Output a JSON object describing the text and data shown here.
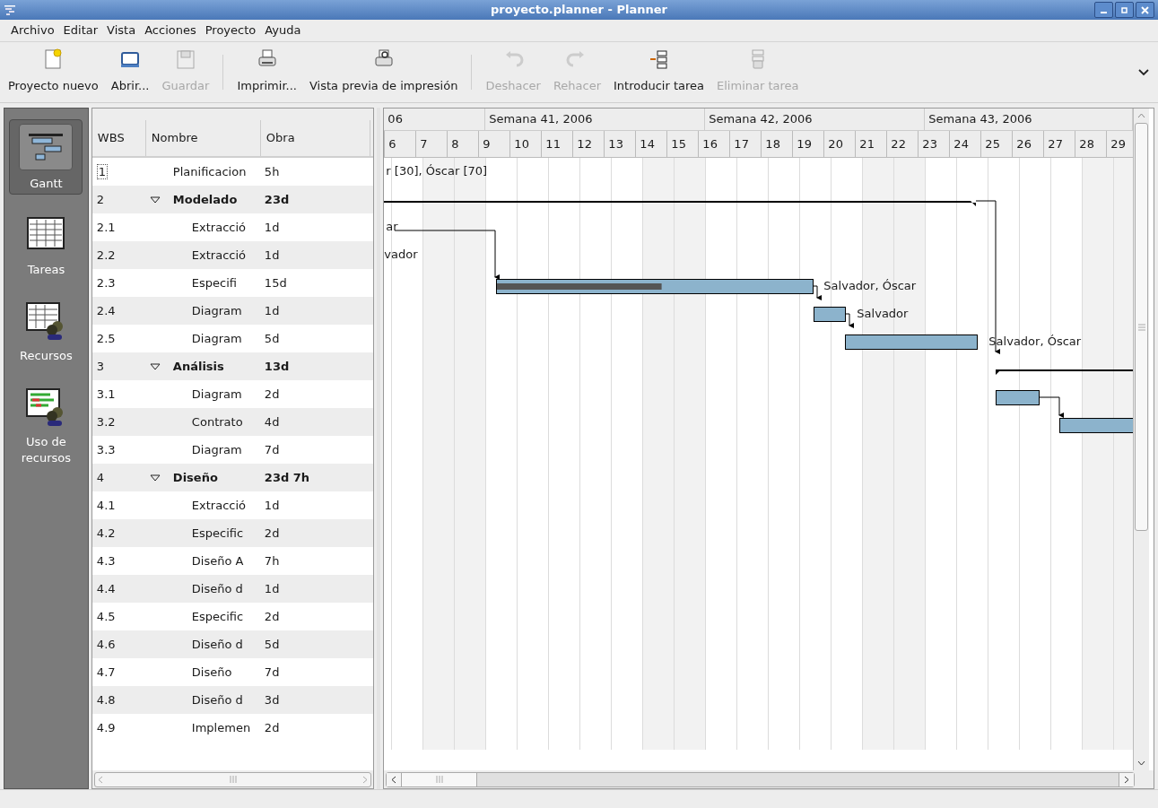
{
  "window": {
    "title": "proyecto.planner - Planner"
  },
  "menu": [
    "Archivo",
    "Editar",
    "Vista",
    "Acciones",
    "Proyecto",
    "Ayuda"
  ],
  "toolbar": [
    {
      "kind": "new",
      "label": "Proyecto nuevo",
      "disabled": false
    },
    {
      "kind": "open",
      "label": "Abrir...",
      "disabled": false
    },
    {
      "kind": "save",
      "label": "Guardar",
      "disabled": true
    },
    {
      "kind": "separator"
    },
    {
      "kind": "print",
      "label": "Imprimir...",
      "disabled": false
    },
    {
      "kind": "preview",
      "label": "Vista previa de impresión",
      "disabled": false
    },
    {
      "kind": "separator"
    },
    {
      "kind": "undo",
      "label": "Deshacer",
      "disabled": true
    },
    {
      "kind": "redo",
      "label": "Rehacer",
      "disabled": true
    },
    {
      "kind": "insert",
      "label": "Introducir tarea",
      "disabled": false
    },
    {
      "kind": "delete",
      "label": "Eliminar tarea",
      "disabled": true
    }
  ],
  "sidebar": [
    {
      "kind": "gantt",
      "label": "Gantt",
      "selected": true
    },
    {
      "kind": "tasks",
      "label": "Tareas",
      "selected": false
    },
    {
      "kind": "resources",
      "label": "Recursos",
      "selected": false
    },
    {
      "kind": "usage",
      "label": "Uso de recursos",
      "selected": false
    }
  ],
  "task_table": {
    "columns": [
      "WBS",
      "Nombre",
      "Obra"
    ],
    "rows": [
      {
        "wbs": "1",
        "name": "Planificacion",
        "work": "5h"
      },
      {
        "wbs": "2",
        "name": "Modelado",
        "work": "23d",
        "expanded": true,
        "children": [
          {
            "wbs": "2.1",
            "name": "Extracció",
            "work": "1d"
          },
          {
            "wbs": "2.2",
            "name": "Extracció",
            "work": "1d"
          },
          {
            "wbs": "2.3",
            "name": "Especifi",
            "work": "15d"
          },
          {
            "wbs": "2.4",
            "name": "Diagram",
            "work": "1d"
          },
          {
            "wbs": "2.5",
            "name": "Diagram",
            "work": "5d"
          }
        ]
      },
      {
        "wbs": "3",
        "name": "Análisis",
        "work": "13d",
        "expanded": true,
        "children": [
          {
            "wbs": "3.1",
            "name": "Diagram",
            "work": "2d"
          },
          {
            "wbs": "3.2",
            "name": "Contrato",
            "work": "4d"
          },
          {
            "wbs": "3.3",
            "name": "Diagram",
            "work": "7d"
          }
        ]
      },
      {
        "wbs": "4",
        "name": "Diseño",
        "work": "23d 7h",
        "expanded": true,
        "children": [
          {
            "wbs": "4.1",
            "name": "Extracció",
            "work": "1d"
          },
          {
            "wbs": "4.2",
            "name": "Especific",
            "work": "2d"
          },
          {
            "wbs": "4.3",
            "name": "Diseño A",
            "work": "7h"
          },
          {
            "wbs": "4.4",
            "name": "Diseño d",
            "work": "1d"
          },
          {
            "wbs": "4.5",
            "name": "Especific",
            "work": "2d"
          },
          {
            "wbs": "4.6",
            "name": "Diseño d",
            "work": "5d"
          },
          {
            "wbs": "4.7",
            "name": "Diseño",
            "work": "7d"
          },
          {
            "wbs": "4.8",
            "name": "Diseño d",
            "work": "3d"
          },
          {
            "wbs": "4.9",
            "name": "Implemen",
            "work": "2d"
          }
        ]
      }
    ]
  },
  "gantt": {
    "weeks": [
      "06",
      "Semana 41, 2006",
      "Semana 42, 2006",
      "Semana 43, 2006"
    ],
    "days": [
      "6",
      "7",
      "8",
      "9",
      "10",
      "11",
      "12",
      "13",
      "14",
      "15",
      "16",
      "17",
      "18",
      "19",
      "20",
      "21",
      "22",
      "23",
      "24",
      "25",
      "26",
      "27",
      "28",
      "29"
    ],
    "rows": [
      {
        "kind": "label",
        "label": "r [30], Óscar [70]"
      },
      {
        "kind": "summary"
      },
      {
        "kind": "label",
        "label": "ar"
      },
      {
        "kind": "label",
        "label": "vador"
      },
      {
        "kind": "task",
        "label": "Salvador, Óscar",
        "level": 0.52
      },
      {
        "kind": "task",
        "label": "Salvador"
      },
      {
        "kind": "task",
        "label": "Salvador, Óscar"
      },
      {
        "kind": "summary"
      },
      {
        "kind": "task"
      },
      {
        "kind": "task"
      }
    ]
  }
}
